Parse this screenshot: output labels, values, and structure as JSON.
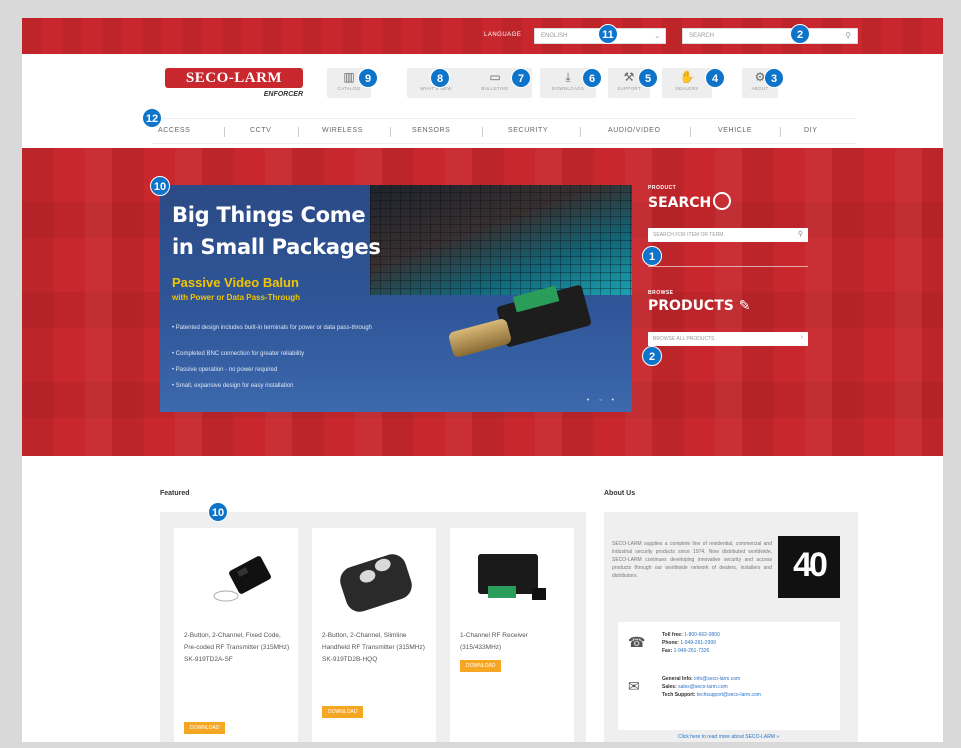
{
  "topbar": {
    "language_label": "LANGUAGE",
    "language_value": "ENGLISH",
    "search_placeholder": "SEARCH"
  },
  "brand": {
    "name": "SECO-LARM",
    "tagline": "ENFORCER"
  },
  "quick_links": [
    "CATALOG",
    "WHAT'S NEW",
    "BULLETINS",
    "DOWNLOADS",
    "SUPPORT",
    "DEALERS",
    "ABOUT"
  ],
  "nav": [
    "ACCESS",
    "CCTV",
    "WIRELESS",
    "SENSORS",
    "SECURITY",
    "AUDIO/VIDEO",
    "VEHICLE",
    "DIY"
  ],
  "hero": {
    "headline1": "Big Things Come",
    "headline2": "in Small Packages",
    "subhead1": "Passive Video Balun",
    "subhead2": "with Power or Data Pass-Through",
    "bullets": [
      "Patented design includes built-in terminals for power or data pass-through",
      "Completed BNC connection for greater reliability",
      "Passive operation - no power required",
      "Small, expansive design for easy installation"
    ],
    "pager": "• ◦ •"
  },
  "sidebar": {
    "search_kicker": "PRODUCT",
    "search_title": "SEARCH",
    "search_placeholder": "SEARCH FOR ITEM OR TERM",
    "products_kicker": "BROWSE",
    "products_title": "PRODUCTS",
    "products_placeholder": "BROWSE ALL PRODUCTS"
  },
  "featured": {
    "label": "Featured",
    "download_label": "DOWNLOAD",
    "items": [
      {
        "title": "2-Button, 2-Channel, Fixed Code, Pre-coded RF Transmitter (315MHz) SK-919TD2A-SF"
      },
      {
        "title": "2-Button, 2-Channel, Slimline Handheld RF Transmitter (315MHz) SK-919TD2B-HQQ"
      },
      {
        "title": "1-Channel RF Receiver (315/433MHz)"
      }
    ]
  },
  "about": {
    "label": "About Us",
    "text": "SECO-LARM supplies a complete line of residential, commercial and industrial security products since 1974. Now distributed worldwide, SECO-LARM continues developing innovative security and access products through our worldwide network of dealers, installers and distributors.",
    "forty": "40",
    "contact": {
      "toll_free_label": "Toll free:",
      "toll_free": "1-800-662-0800",
      "phone_label": "Phone:",
      "phone": "1-949-261-2999",
      "fax_label": "Fax:",
      "fax": "1-949-261-7326",
      "general_label": "General Info:",
      "general": "info@seco-larm.com",
      "sales_label": "Sales:",
      "sales": "sales@seco-larm.com",
      "tech_label": "Tech Support:",
      "tech": "techsupport@seco-larm.com"
    },
    "more_link": "Click here to read more about SECO-LARM »"
  },
  "badges": {
    "search_top": "2",
    "about": "3",
    "dealers": "4",
    "support": "5",
    "downloads": "6",
    "bulletins": "7",
    "whatsnew": "8",
    "catalog": "9",
    "banner": "10",
    "language": "11",
    "nav": "12",
    "product_search": "1",
    "browse": "2",
    "featured": "10"
  }
}
